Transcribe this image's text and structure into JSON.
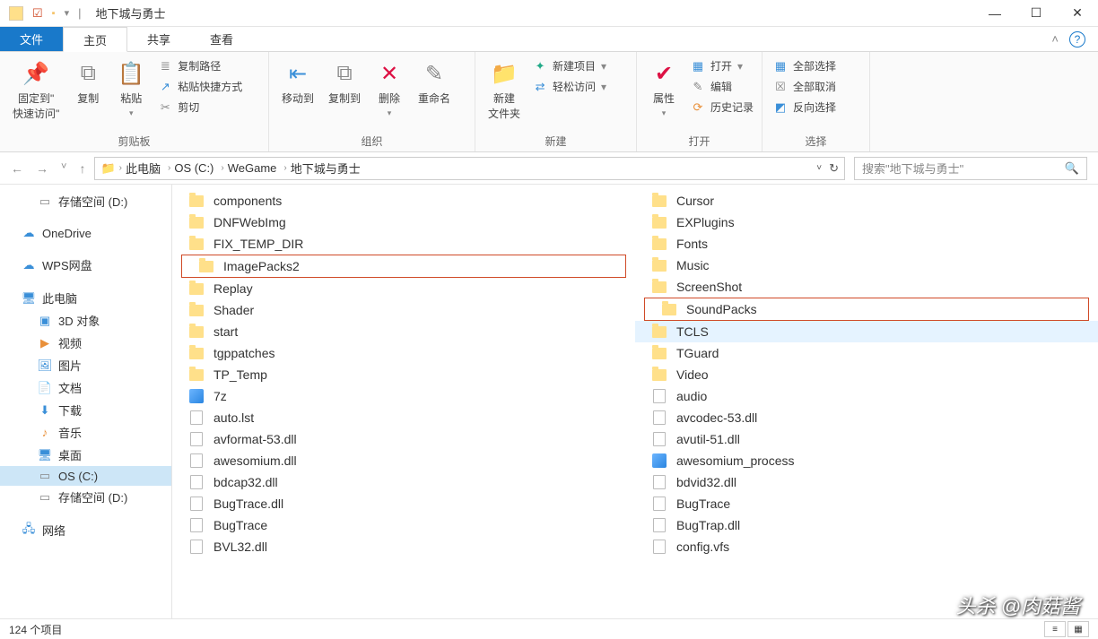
{
  "window": {
    "title": "地下城与勇士"
  },
  "tabs": {
    "file": "文件",
    "home": "主页",
    "share": "共享",
    "view": "查看"
  },
  "ribbon": {
    "clipboard": {
      "label": "剪贴板",
      "pin": "固定到\"\n快速访问\"",
      "copy": "复制",
      "paste": "粘贴",
      "copy_path": "复制路径",
      "paste_shortcut": "粘贴快捷方式",
      "cut": "剪切"
    },
    "organize": {
      "label": "组织",
      "moveto": "移动到",
      "copyto": "复制到",
      "delete": "删除",
      "rename": "重命名"
    },
    "new": {
      "label": "新建",
      "newfolder": "新建\n文件夹",
      "newitem": "新建项目",
      "easyaccess": "轻松访问"
    },
    "open": {
      "label": "打开",
      "properties": "属性",
      "open": "打开",
      "edit": "编辑",
      "history": "历史记录"
    },
    "select": {
      "label": "选择",
      "selectall": "全部选择",
      "selectnone": "全部取消",
      "invert": "反向选择"
    }
  },
  "breadcrumb": {
    "segs": [
      "此电脑",
      "OS (C:)",
      "WeGame",
      "地下城与勇士"
    ],
    "refresh_title": "刷新"
  },
  "search": {
    "placeholder": "搜索\"地下城与勇士\""
  },
  "tree": {
    "storage_d": "存储空间 (D:)",
    "onedrive": "OneDrive",
    "wps": "WPS网盘",
    "thispc": "此电脑",
    "obj3d": "3D 对象",
    "videos": "视频",
    "pictures": "图片",
    "documents": "文档",
    "downloads": "下载",
    "music": "音乐",
    "desktop": "桌面",
    "os_c": "OS (C:)",
    "storage_d2": "存储空间 (D:)",
    "network": "网络"
  },
  "files_left": [
    {
      "name": "components",
      "type": "folder"
    },
    {
      "name": "DNFWebImg",
      "type": "folder"
    },
    {
      "name": "FIX_TEMP_DIR",
      "type": "folder"
    },
    {
      "name": "ImagePacks2",
      "type": "folder",
      "highlight": true
    },
    {
      "name": "Replay",
      "type": "folder"
    },
    {
      "name": "Shader",
      "type": "folder"
    },
    {
      "name": "start",
      "type": "folder"
    },
    {
      "name": "tgppatches",
      "type": "folder"
    },
    {
      "name": "TP_Temp",
      "type": "folder"
    },
    {
      "name": "7z",
      "type": "exe"
    },
    {
      "name": "auto.lst",
      "type": "file"
    },
    {
      "name": "avformat-53.dll",
      "type": "file"
    },
    {
      "name": "awesomium.dll",
      "type": "file"
    },
    {
      "name": "bdcap32.dll",
      "type": "file"
    },
    {
      "name": "BugTrace.dll",
      "type": "file"
    },
    {
      "name": "BugTrace",
      "type": "file"
    },
    {
      "name": "BVL32.dll",
      "type": "file"
    }
  ],
  "files_right": [
    {
      "name": "Cursor",
      "type": "folder"
    },
    {
      "name": "EXPlugins",
      "type": "folder"
    },
    {
      "name": "Fonts",
      "type": "folder"
    },
    {
      "name": "Music",
      "type": "folder"
    },
    {
      "name": "ScreenShot",
      "type": "folder"
    },
    {
      "name": "SoundPacks",
      "type": "folder",
      "highlight": true
    },
    {
      "name": "TCLS",
      "type": "folder",
      "hovered": true
    },
    {
      "name": "TGuard",
      "type": "folder"
    },
    {
      "name": "Video",
      "type": "folder"
    },
    {
      "name": "audio",
      "type": "file"
    },
    {
      "name": "avcodec-53.dll",
      "type": "file"
    },
    {
      "name": "avutil-51.dll",
      "type": "file"
    },
    {
      "name": "awesomium_process",
      "type": "exe"
    },
    {
      "name": "bdvid32.dll",
      "type": "file"
    },
    {
      "name": "BugTrace",
      "type": "file"
    },
    {
      "name": "BugTrap.dll",
      "type": "file"
    },
    {
      "name": "config.vfs",
      "type": "file"
    }
  ],
  "status": {
    "count": "124 个项目"
  },
  "watermark": "头杀 @肉菇酱"
}
